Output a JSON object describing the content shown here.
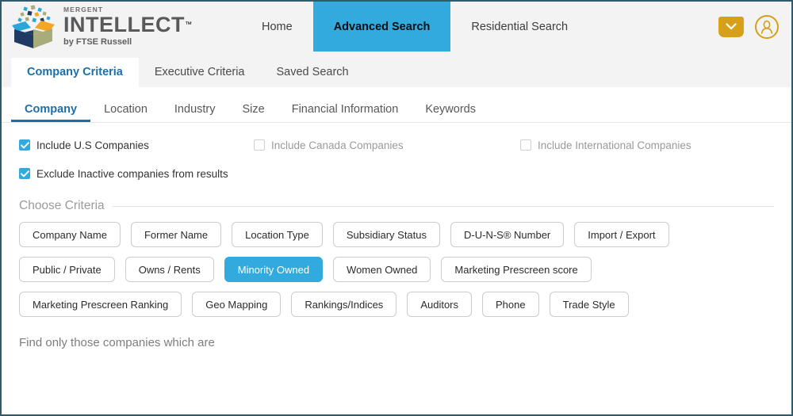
{
  "brand": {
    "mergent": "MERGENT",
    "intellect": "INTELLECT",
    "tm": "™",
    "by_line": "by FTSE Russell",
    "colors": {
      "navy": "#1f3a63",
      "olive": "#a8ac7a",
      "cyan": "#29a7d8",
      "orange": "#f5a623",
      "gold": "#d6a018"
    }
  },
  "topnav": {
    "items": [
      {
        "label": "Home",
        "active": false
      },
      {
        "label": "Advanced Search",
        "active": true
      },
      {
        "label": "Residential Search",
        "active": false
      }
    ],
    "dropdown_icon": "chevron-down-icon",
    "account_icon": "user-avatar-icon",
    "accent_color": "#33AADE"
  },
  "tabs": {
    "items": [
      {
        "label": "Company Criteria",
        "active": true
      },
      {
        "label": "Executive Criteria",
        "active": false
      },
      {
        "label": "Saved Search",
        "active": false
      }
    ]
  },
  "subtabs": {
    "items": [
      {
        "label": "Company",
        "active": true
      },
      {
        "label": "Location",
        "active": false
      },
      {
        "label": "Industry",
        "active": false
      },
      {
        "label": "Size",
        "active": false
      },
      {
        "label": "Financial Information",
        "active": false
      },
      {
        "label": "Keywords",
        "active": false
      }
    ]
  },
  "checkboxes": [
    {
      "label": "Include U.S Companies",
      "checked": true,
      "disabled": false
    },
    {
      "label": "Include Canada Companies",
      "checked": false,
      "disabled": true
    },
    {
      "label": "Include International Companies",
      "checked": false,
      "disabled": true
    },
    {
      "label": "Exclude Inactive companies from results",
      "checked": true,
      "disabled": false
    }
  ],
  "choose_criteria": {
    "heading": "Choose Criteria",
    "rows": [
      [
        {
          "label": "Company Name",
          "selected": false
        },
        {
          "label": "Former Name",
          "selected": false
        },
        {
          "label": "Location Type",
          "selected": false
        },
        {
          "label": "Subsidiary Status",
          "selected": false
        },
        {
          "label": "D-U-N-S® Number",
          "selected": false
        },
        {
          "label": "Import / Export",
          "selected": false
        }
      ],
      [
        {
          "label": "Public / Private",
          "selected": false
        },
        {
          "label": "Owns / Rents",
          "selected": false
        },
        {
          "label": "Minority Owned",
          "selected": true
        },
        {
          "label": "Women Owned",
          "selected": false
        },
        {
          "label": "Marketing Prescreen score",
          "selected": false
        }
      ],
      [
        {
          "label": "Marketing Prescreen Ranking",
          "selected": false
        },
        {
          "label": "Geo Mapping",
          "selected": false
        },
        {
          "label": "Rankings/Indices",
          "selected": false
        },
        {
          "label": "Auditors",
          "selected": false
        },
        {
          "label": "Phone",
          "selected": false
        },
        {
          "label": "Trade Style",
          "selected": false
        }
      ]
    ]
  },
  "footer": {
    "prompt": "Find only those companies which are"
  }
}
